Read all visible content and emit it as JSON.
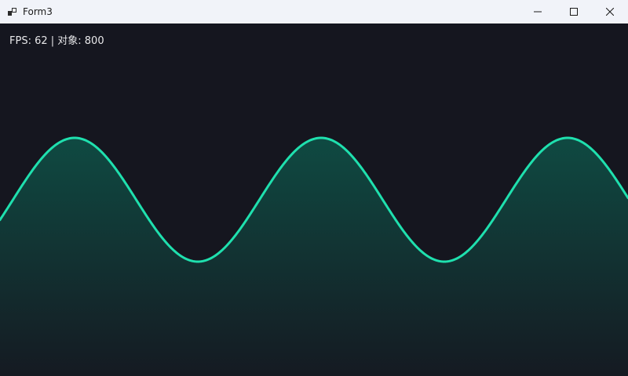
{
  "window": {
    "title": "Form3",
    "controls": {
      "minimize_icon": "minimize-icon",
      "maximize_icon": "maximize-icon",
      "close_icon": "close-icon"
    }
  },
  "hud": {
    "fps_label": "FPS",
    "fps_value": "62",
    "objects_label": "对象",
    "objects_value": "800",
    "text": "FPS: 62 | 对象: 800"
  },
  "colors": {
    "background": "#15161f",
    "wave_stroke": "#1fe0ae",
    "wave_fill_top": "#0f4a42",
    "wave_fill_bottom": "#151a22",
    "titlebar": "#f1f3f9"
  },
  "wave": {
    "shape": "sine",
    "cycles_visible": 2.5,
    "peaks": 3,
    "troughs": 2
  }
}
